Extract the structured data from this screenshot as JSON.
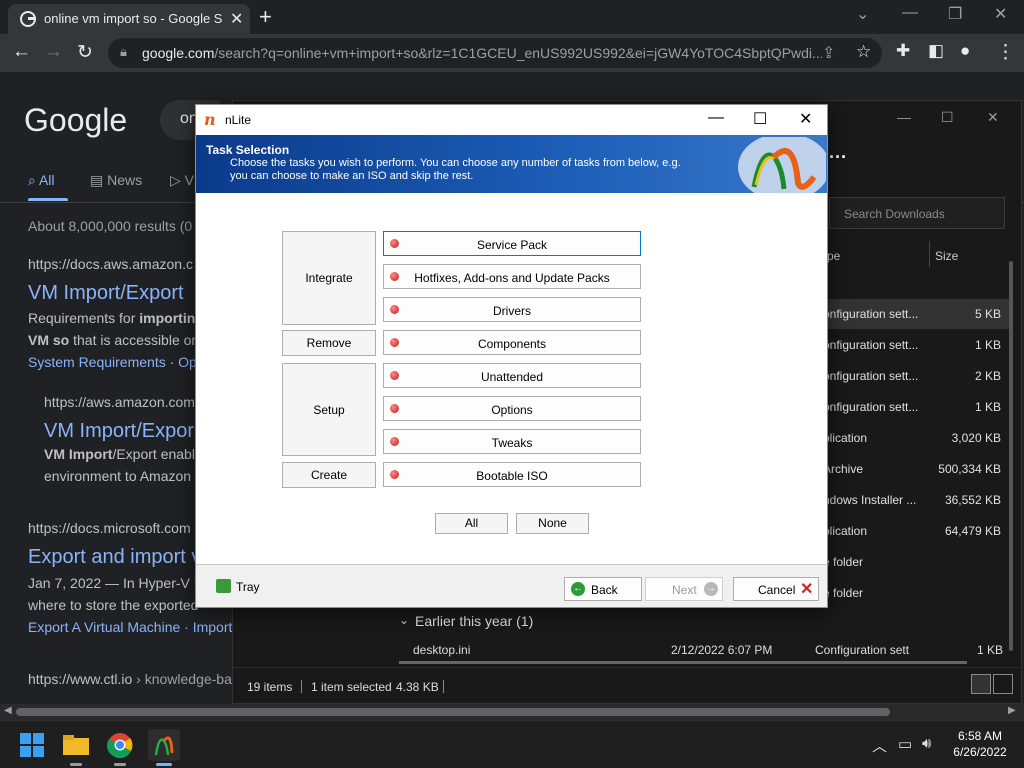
{
  "browser": {
    "tab_title": "online vm import so - Google Se",
    "url_domain": "google.com",
    "url_rest": "/search?q=online+vm+import+so&rlz=1C1GCEU_enUS992US992&ei=jGW4YoTOC4SbptQPwdi..."
  },
  "google": {
    "logo": "Google",
    "search_partial": "on",
    "nav": {
      "all": "All",
      "news": "News",
      "v": "V"
    },
    "results_count": "About 8,000,000 results (0",
    "r1": {
      "cite": "https://docs.aws.amazon.c",
      "title": "VM Import/Export",
      "line1a": "Requirements for ",
      "line1b": "importing",
      "line2a": "VM so",
      "line2b": " that is accessible or",
      "sub1": "System Requirements",
      "sub_sep": " · ",
      "sub2": "Ope"
    },
    "r1b": {
      "cite": "https://aws.amazon.com",
      "title": "VM Import/Expor",
      "line1a": "VM Import",
      "line1b": "/Export enabl",
      "line2": "environment to Amazon"
    },
    "r2": {
      "cite": "https://docs.microsoft.com",
      "title": "Export and import v",
      "line1": "Jan 7, 2022 — In Hyper-V M",
      "line2": "where to store the exported",
      "sub": "Export A Virtual Machine · Import"
    },
    "r3": {
      "cite": "https://www.ctl.io",
      "cite_path": " › knowledge-ba"
    }
  },
  "explorer": {
    "search_placeholder": "Search Downloads",
    "col_type": "pe",
    "col_size": "Size",
    "rows": [
      {
        "type": "onfiguration sett...",
        "size": "5 KB",
        "selected": true
      },
      {
        "type": "onfiguration sett...",
        "size": "1 KB"
      },
      {
        "type": "onfiguration sett...",
        "size": "2 KB"
      },
      {
        "type": "onfiguration sett...",
        "size": "1 KB"
      },
      {
        "type": "plication",
        "size": "3,020 KB"
      },
      {
        "type": "Archive",
        "size": "500,334 KB"
      },
      {
        "type": "ndows Installer ...",
        "size": "36,552 KB"
      },
      {
        "type": "plication",
        "size": "64,479 KB"
      },
      {
        "type": "e folder",
        "size": ""
      },
      {
        "type": "e folder",
        "size": ""
      }
    ],
    "group_label": "Earlier this year (1)",
    "last_row": {
      "name": "desktop.ini",
      "date": "2/12/2022 6:07 PM",
      "type": "Configuration sett",
      "size": "1 KB"
    },
    "status": {
      "items": "19 items",
      "selected": "1 item selected",
      "size": "4.38 KB"
    }
  },
  "nlite": {
    "title": "nLite",
    "header_title": "Task Selection",
    "header_desc": "Choose the tasks you wish to perform. You can choose any number of tasks from below, e.g. you can choose to make an ISO and skip the rest.",
    "groups": {
      "integrate": "Integrate",
      "remove": "Remove",
      "setup": "Setup",
      "create": "Create"
    },
    "tasks": [
      "Service Pack",
      "Hotfixes, Add-ons and Update Packs",
      "Drivers",
      "Components",
      "Unattended",
      "Options",
      "Tweaks",
      "Bootable ISO"
    ],
    "btn_all": "All",
    "btn_none": "None",
    "tray": "Tray",
    "back": "Back",
    "next": "Next",
    "cancel": "Cancel"
  },
  "taskbar": {
    "time": "6:58 AM",
    "date": "6/26/2022"
  }
}
